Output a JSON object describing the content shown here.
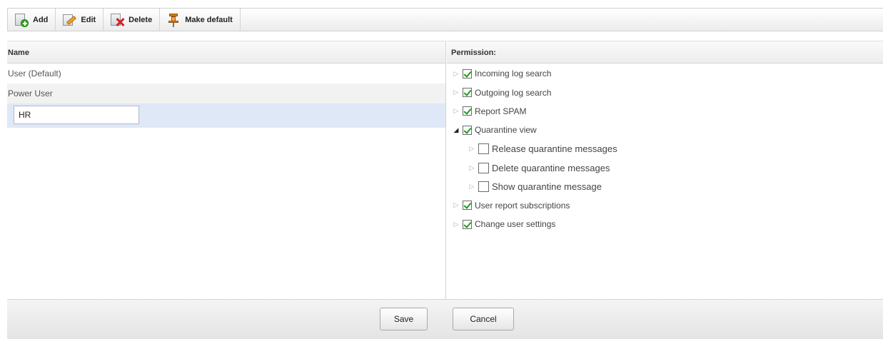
{
  "toolbar": {
    "add_label": "Add",
    "edit_label": "Edit",
    "delete_label": "Delete",
    "make_default_label": "Make default"
  },
  "left": {
    "header": "Name",
    "rows": [
      "User (Default)",
      "Power User"
    ],
    "edit_value": "HR"
  },
  "right": {
    "header": "Permission:",
    "permissions": [
      {
        "label": "Incoming log search",
        "checked": true
      },
      {
        "label": "Outgoing log search",
        "checked": true
      },
      {
        "label": "Report SPAM",
        "checked": true
      },
      {
        "label": "Quarantine view",
        "checked": true,
        "expanded": true,
        "children": [
          {
            "label": "Release quarantine messages",
            "checked": false
          },
          {
            "label": "Delete quarantine messages",
            "checked": false
          },
          {
            "label": "Show quarantine message",
            "checked": false
          }
        ]
      },
      {
        "label": "User report subscriptions",
        "checked": true
      },
      {
        "label": "Change user settings",
        "checked": true
      }
    ]
  },
  "footer": {
    "save_label": "Save",
    "cancel_label": "Cancel"
  },
  "icons": {
    "add": "add-document-icon",
    "edit": "edit-document-icon",
    "delete": "delete-document-icon",
    "make_default": "pin-icon",
    "collapsed": "triangle-right-icon",
    "expanded": "triangle-down-icon",
    "checkmark_color": "#1e9a1e",
    "selected_row_color": "#dfe8f6"
  }
}
